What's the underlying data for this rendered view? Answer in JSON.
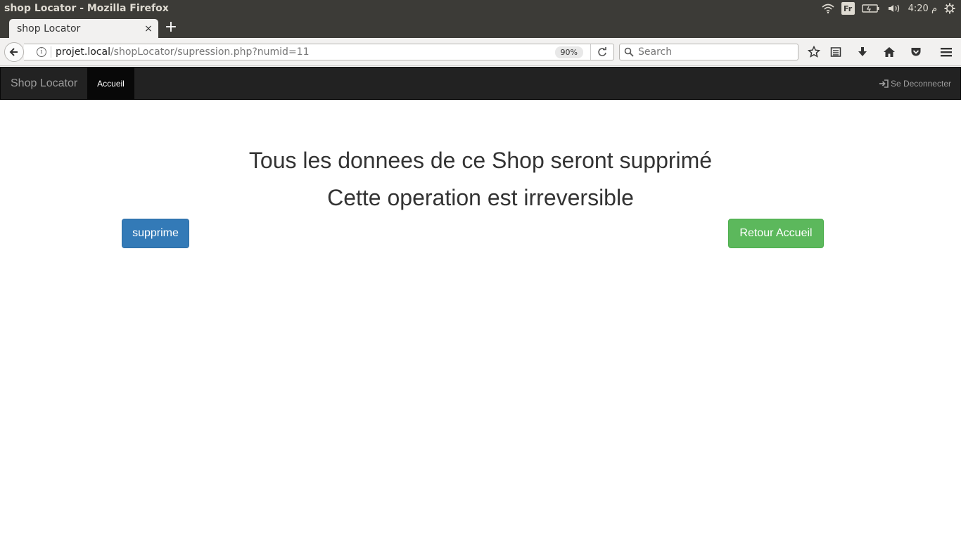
{
  "os": {
    "window_title": "shop Locator - Mozilla Firefox",
    "keyboard_layout": "Fr",
    "clock": "4:20 م"
  },
  "browser": {
    "tab_title": "shop Locator",
    "tab_close": "×",
    "new_tab": "+",
    "url_host": "projet.local",
    "url_path": "/shopLocator/supression.php?numid=11",
    "zoom": "90%",
    "search_placeholder": "Search"
  },
  "navbar": {
    "brand": "Shop Locator",
    "active_item": "Accueil",
    "logout_label": "Se Deconnecter"
  },
  "content": {
    "warning_line1": "Tous les donnees de ce Shop seront supprimé",
    "warning_line2": "Cette operation est irreversible",
    "delete_button": "supprime",
    "home_button": "Retour Accueil"
  },
  "colors": {
    "navbar_bg": "#222222",
    "primary": "#337ab7",
    "success": "#5cb85c"
  }
}
